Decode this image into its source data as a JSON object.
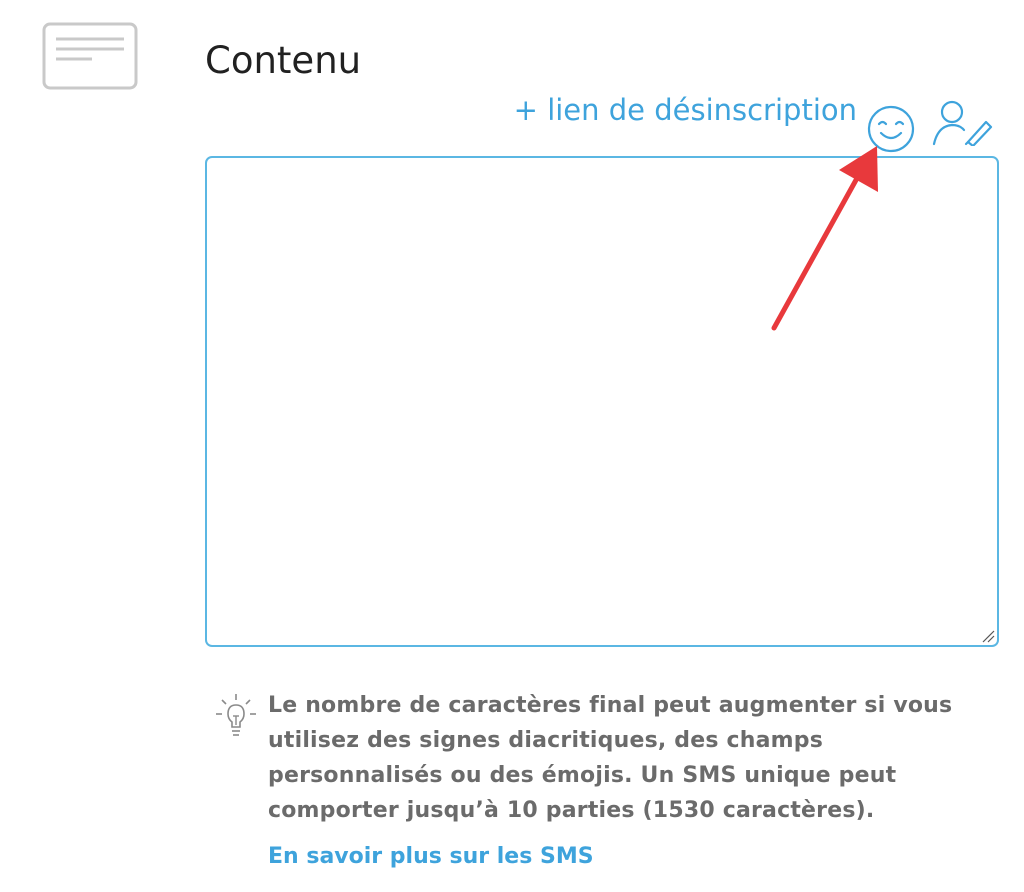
{
  "section": {
    "icon": "document-lines-icon",
    "title": "Contenu"
  },
  "toolbar": {
    "unsubscribe_link": "+ lien de désinscription",
    "emoji_icon": "smiley-icon",
    "personalize_icon": "user-edit-icon"
  },
  "editor": {
    "value": "",
    "placeholder": ""
  },
  "tip": {
    "icon": "lightbulb-icon",
    "text": "Le nombre de caractères final peut augmenter si vous utilisez des signes diacritiques, des champs personnalisés ou des émojis. Un SMS unique peut comporter jusqu’à 10 parties (1530 caractères).",
    "link": "En savoir plus sur les SMS"
  },
  "colors": {
    "accent": "#3ea3dc",
    "border": "#5bb7e3",
    "annotation": "#e8393c",
    "muted": "#6b6b6b",
    "title": "#212121"
  }
}
